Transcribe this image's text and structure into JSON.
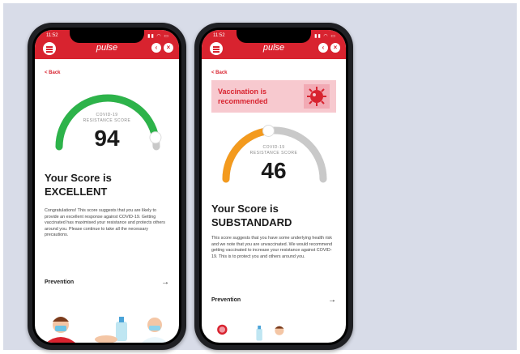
{
  "colors": {
    "brand_red": "#d8232f",
    "excellent_green": "#2db34a",
    "substandard_orange": "#f39a1e",
    "track_grey": "#c9c9c9"
  },
  "app": {
    "brand": "pulse"
  },
  "phones": [
    {
      "status_time": "11:52",
      "back": "< Back",
      "gauge_caption_line1": "COVID-19",
      "gauge_caption_line2": "RESISTANCE SCORE",
      "score": "94",
      "score_fraction": 0.94,
      "headline_line1": "Your Score is",
      "headline_line2": "EXCELLENT",
      "body": "Congratulations! This score suggests that you are likely to provide an excellent response against COVID-19. Getting vaccinated has maximised your resistance and protects others around you. Please continue to take all the necessary precautions.",
      "prevention": "Prevention"
    },
    {
      "status_time": "11:52",
      "back": "< Back",
      "banner_line1": "Vaccination is",
      "banner_line2": "recommended",
      "gauge_caption_line1": "COVID-19",
      "gauge_caption_line2": "RESISTANCE SCORE",
      "score": "46",
      "score_fraction": 0.46,
      "headline_line1": "Your Score is",
      "headline_line2": "SUBSTANDARD",
      "body": "This score suggests that you have some underlying health risk and we note that you are unvaccinated. We would recommend getting vaccinated to increase your resistance against COVID-19. This is to protect you and others around you.",
      "prevention": "Prevention"
    }
  ]
}
